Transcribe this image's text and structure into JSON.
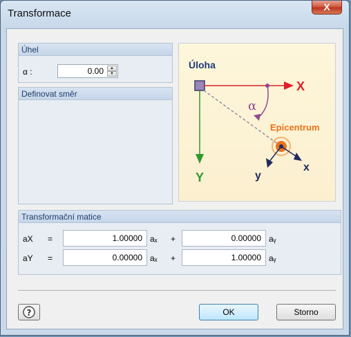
{
  "window": {
    "title": "Transformace",
    "close_label": "X"
  },
  "angle_group": {
    "title": "Úhel",
    "alpha_label": "α :",
    "alpha_value": "0.00"
  },
  "direction_group": {
    "title": "Definovat směr"
  },
  "diagram": {
    "task_label": "Úloha",
    "big_x": "X",
    "big_y": "Y",
    "alpha": "α",
    "epicenter": "Epicentrum",
    "small_x": "x",
    "small_y": "y"
  },
  "matrix_group": {
    "title": "Transformační matice",
    "rows": [
      {
        "lhs": "aX",
        "eq": "=",
        "c1": "1.00000",
        "term1": "aₓ",
        "plus": "+",
        "c2": "0.00000",
        "term2": "aᵧ"
      },
      {
        "lhs": "aY",
        "eq": "=",
        "c1": "0.00000",
        "term1": "aₓ",
        "plus": "+",
        "c2": "1.00000",
        "term2": "aᵧ"
      }
    ]
  },
  "buttons": {
    "ok": "OK",
    "cancel": "Storno"
  },
  "colors": {
    "accent_red": "#e0202a",
    "accent_green": "#2e9a2e",
    "accent_orange": "#e8741c",
    "accent_purple": "#8e4a8e",
    "task_blue": "#1e3a78"
  }
}
